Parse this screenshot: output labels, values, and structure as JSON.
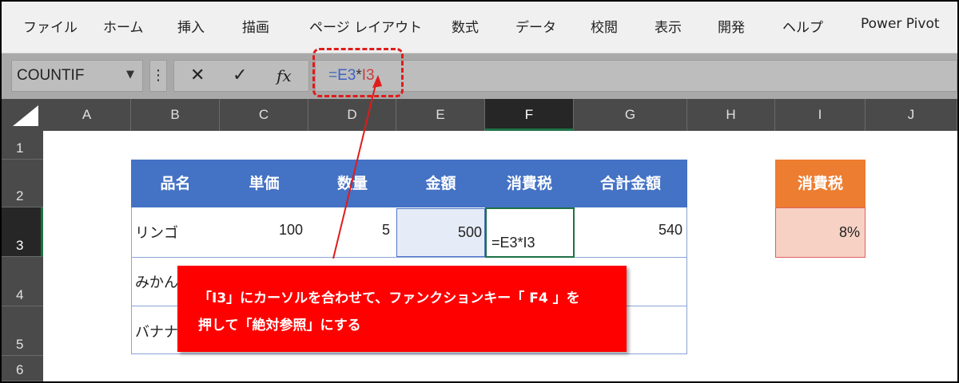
{
  "menu": [
    "ファイル",
    "ホーム",
    "挿入",
    "描画",
    "ページ レイアウト",
    "数式",
    "データ",
    "校閲",
    "表示",
    "開発",
    "ヘルプ",
    "Power Pivot"
  ],
  "formula_bar": {
    "name_box": "COUNTIF",
    "sep": "⋮",
    "cancel": "✕",
    "enter": "✓",
    "fx": "fx",
    "formula_parts": {
      "eq": "=",
      "ref1": "E3",
      "op": "*",
      "ref2": "I3"
    }
  },
  "columns": [
    "A",
    "B",
    "C",
    "D",
    "E",
    "F",
    "G",
    "H",
    "I",
    "J"
  ],
  "rows": [
    "1",
    "2",
    "3",
    "4",
    "5",
    "6"
  ],
  "table": {
    "headers": [
      "品名",
      "単価",
      "数量",
      "金額",
      "消費税",
      "合計金額"
    ],
    "row1": {
      "item": "リンゴ",
      "price": "100",
      "qty": "5",
      "amount": "500",
      "tax_formula": "=E3*I3",
      "total": "540"
    },
    "row2": {
      "item": "みかん"
    },
    "row3": {
      "item": "バナナ"
    }
  },
  "tax_box": {
    "header": "消費税",
    "value": "8%"
  },
  "callout": {
    "line1": "「I3」にカーソルを合わせて、ファンクションキー「 F4 」を",
    "line2": "押して「絶対参照」にする"
  },
  "colors": {
    "table_header": "#4472c4",
    "tax_header": "#ed7d31",
    "callout": "#ff0000",
    "highlight": "#e01b1b"
  }
}
